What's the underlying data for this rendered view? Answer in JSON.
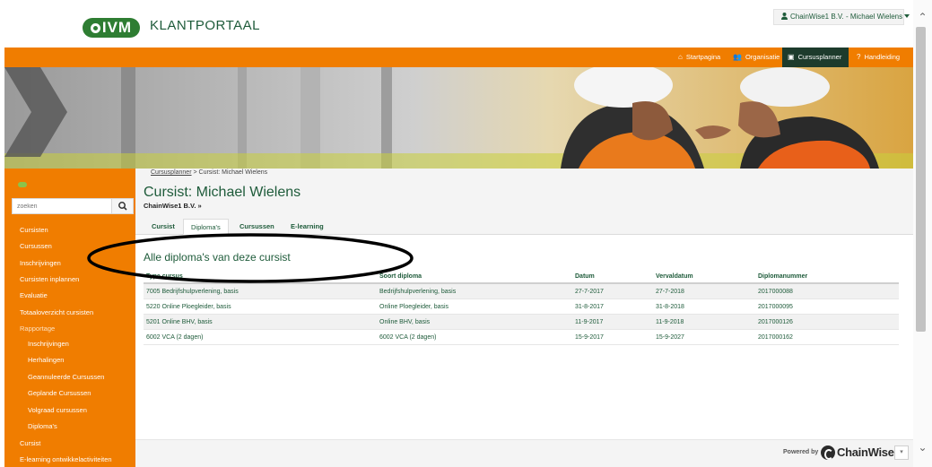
{
  "header": {
    "logo_text": "IVM",
    "portal_title": "KLANTPORTAAL",
    "user_menu": "ChainWise1 B.V. - Michael Wielens"
  },
  "topnav": {
    "items": [
      {
        "label": "Startpagina",
        "icon": "home-icon"
      },
      {
        "label": "Organisatie",
        "icon": "users-icon"
      },
      {
        "label": "Cursusplanner",
        "icon": "calendar-icon",
        "active": true
      },
      {
        "label": "Handleiding",
        "icon": "question-circle-icon"
      }
    ]
  },
  "sidebar": {
    "search_placeholder": "zoeken",
    "items": [
      {
        "label": "Cursisten"
      },
      {
        "label": "Cursussen"
      },
      {
        "label": "Inschrijvingen"
      },
      {
        "label": "Cursisten inplannen"
      },
      {
        "label": "Evaluatie"
      },
      {
        "label": "Totaaloverzicht cursisten"
      },
      {
        "label": "Rapportage"
      },
      {
        "label": "Inschrijvingen"
      },
      {
        "label": "Herhalingen"
      },
      {
        "label": "Geannuleerde Cursussen"
      },
      {
        "label": "Geplande Cursussen"
      },
      {
        "label": "Volgraad cursussen"
      },
      {
        "label": "Diploma's"
      },
      {
        "label": "Cursist"
      },
      {
        "label": "E-learning ontwikkelactiviteiten"
      }
    ]
  },
  "main": {
    "breadcrumb_link": "Cursusplanner",
    "breadcrumb_rest": " > Cursist: Michael Wielens",
    "title": "Cursist: Michael Wielens",
    "company_link": "ChainWise1 B.V. »",
    "tabs": [
      {
        "label": "Cursist"
      },
      {
        "label": "Diploma's",
        "active": true
      },
      {
        "label": "Cursussen"
      },
      {
        "label": "E-learning"
      }
    ],
    "section_title": "Alle diploma's van deze cursist",
    "table": {
      "headers": [
        "Type cursus",
        "Soort diploma",
        "Datum",
        "Vervaldatum",
        "Diplomanummer"
      ],
      "rows": [
        [
          "7005 Bedrijfshulpverlening, basis",
          "Bedrijfshulpverlening, basis",
          "27-7-2017",
          "27-7-2018",
          "2017000088"
        ],
        [
          "5220 Online Ploegleider, basis",
          "Online Ploegleider, basis",
          "31-8-2017",
          "31-8-2018",
          "2017000095"
        ],
        [
          "5201 Online BHV, basis",
          "Online BHV, basis",
          "11-9-2017",
          "11-9-2018",
          "2017000126"
        ],
        [
          "6002 VCA (2 dagen)",
          "6002 VCA (2 dagen)",
          "15-9-2017",
          "15-9-2027",
          "2017000162"
        ]
      ]
    }
  },
  "footer": {
    "powered_by": "Powered by",
    "brand": "ChainWise"
  },
  "colors": {
    "orange": "#f07d00",
    "dark_green": "#1e5b3a",
    "nav_active": "#1d3b2c"
  }
}
